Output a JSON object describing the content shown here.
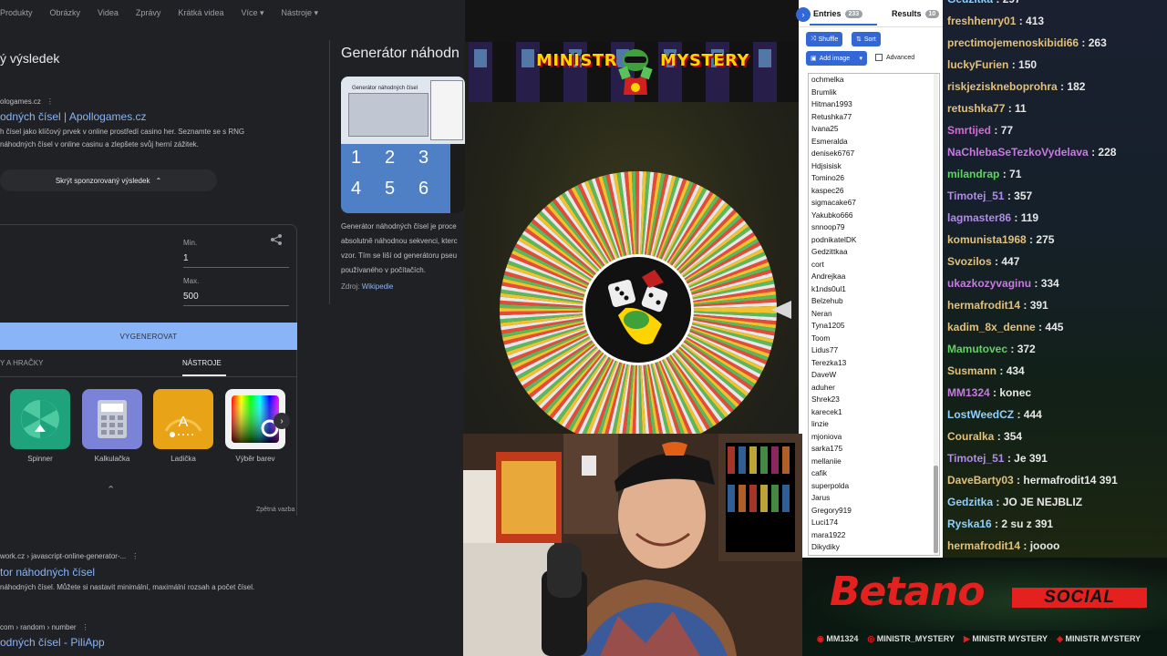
{
  "search": {
    "nav": [
      "Produkty",
      "Obrázky",
      "Videa",
      "Zprávy",
      "Krátká videa",
      "Více ▾",
      "Nástroje ▾"
    ],
    "sponsored_heading": "ý výsledek",
    "result1": {
      "site": "ologames.cz",
      "title": "odných čísel | Apollogames.cz",
      "snippet_line1": "h čísel jako klíčový prvek v online prostředí casino her.  Seznamte se s RNG",
      "snippet_line2": "náhodných čísel v online casinu  a zlepšete svůj herní zážitek."
    },
    "hide_sponsored": "Skrýt sponzorovaný výsledek",
    "rng": {
      "min_label": "Min.",
      "min_value": "1",
      "max_label": "Max.",
      "max_value": "500",
      "generate": "VYGENEROVAT"
    },
    "tools_tabs": [
      "Y A HRAČKY",
      "NÁSTROJE"
    ],
    "tools": [
      {
        "label": "Spinner",
        "color": "#1fa37c"
      },
      {
        "label": "Kalkulačka",
        "color": "#7b83d9"
      },
      {
        "label": "Ladička",
        "color": "#e8a317"
      },
      {
        "label": "Výběr barev",
        "color": "#f2f2f2"
      }
    ],
    "feedback": "Zpětná vazba",
    "result2": {
      "site": "work.cz › javascript-online-generator-...",
      "title": "tor náhodných čísel",
      "snippet": "náhodných čísel. Můžete si nastavit minimální, maximální rozsah a počet čísel."
    },
    "result3": {
      "site": "com › random › number",
      "title": "odných čísel - PiliApp"
    },
    "knowledge": {
      "title": "Generátor náhodn",
      "line1": "Generátor náhodných čísel je proce",
      "line2": "absolutně náhodnou sekvenci, kterc",
      "line3": "vzor. Tím se liší od generátoru pseu",
      "line4": "používaného v počítačích.",
      "source_label": "Zdroj:",
      "source": "Wikipedie",
      "img_title": "Generátor náhodných čísel",
      "img_digits": [
        "1",
        "2",
        "3",
        "4",
        "5",
        "6"
      ]
    }
  },
  "wheel": {
    "banner_left": "MINISTR",
    "banner_right": "MYSTERY",
    "colors": [
      "#f2c12e",
      "#5cb85c",
      "#e8e8e8",
      "#e84a3a",
      "#f2c12e",
      "#5cb85c",
      "#e84a3a",
      "#e8e8e8"
    ]
  },
  "entries": {
    "tab_entries": "Entries",
    "entries_count": "233",
    "tab_results": "Results",
    "results_count": "10",
    "shuffle": "Shuffle",
    "sort": "Sort",
    "add_image": "Add image",
    "advanced": "Advanced",
    "names": [
      "ochmelka",
      "Brumlik",
      "Hitman1993",
      "Retushka77",
      "Ivana25",
      "Esmeralda",
      "denisek6767",
      "Hdjsisisk",
      "Tomino26",
      "kaspec26",
      "sigmacake67",
      "Yakubko666",
      "snnoop79",
      "podnikatelDK",
      "Gedzittkaa",
      "cort",
      "Andrejkaa",
      "k1nds0ul1",
      "Belzehub",
      "Neran",
      "Tyna1205",
      "Toom",
      "Lidus77",
      "Terezka13",
      "DaveW",
      "aduher",
      "Shrek23",
      "karecek1",
      "linzie",
      "mjoniova",
      "sarka175",
      "mellaniie",
      "cafik",
      "superpolda",
      "Jarus",
      "Gregory919",
      "Luci174",
      "mara1922",
      "Dikydiky"
    ]
  },
  "chat": [
    {
      "user": "Gedzitka",
      "msg": "297",
      "color": "#8fd0ff"
    },
    {
      "user": "freshhenry01",
      "msg": "413",
      "color": "#e2c07a"
    },
    {
      "user": "prectimojemenoskibidi66",
      "msg": "263",
      "color": "#e2c07a"
    },
    {
      "user": "luckyFurien",
      "msg": "150",
      "color": "#e2c07a"
    },
    {
      "user": "riskjeziskneboprohra",
      "msg": "182",
      "color": "#e2c07a"
    },
    {
      "user": "retushka77",
      "msg": "11",
      "color": "#e2c07a"
    },
    {
      "user": "Smrtijed",
      "msg": "77",
      "color": "#d66ad6"
    },
    {
      "user": "NaChlebaSeTezkoVydelava",
      "msg": "228",
      "color": "#c87ae0"
    },
    {
      "user": "milandrap",
      "msg": "71",
      "color": "#5fd35f"
    },
    {
      "user": "Timotej_51",
      "msg": "357",
      "color": "#b08ae8"
    },
    {
      "user": "lagmaster86",
      "msg": "119",
      "color": "#b08ae8"
    },
    {
      "user": "komunista1968",
      "msg": "275",
      "color": "#e2c07a"
    },
    {
      "user": "Svozilos",
      "msg": "447",
      "color": "#e2c07a"
    },
    {
      "user": "ukazkozyvaginu",
      "msg": "334",
      "color": "#c87ae0"
    },
    {
      "user": "hermafrodit14",
      "msg": "391",
      "color": "#e2c07a"
    },
    {
      "user": "kadim_8x_denne",
      "msg": "445",
      "color": "#e2c07a"
    },
    {
      "user": "Mamutovec",
      "msg": "372",
      "color": "#5fd35f"
    },
    {
      "user": "Susmann",
      "msg": "434",
      "color": "#e2c07a"
    },
    {
      "user": "MM1324",
      "msg": "konec",
      "color": "#c87ae0"
    },
    {
      "user": "LostWeedCZ",
      "msg": "444",
      "color": "#8fd0ff"
    },
    {
      "user": "Couralka",
      "msg": "354",
      "color": "#e2c07a"
    },
    {
      "user": "Timotej_51",
      "msg": "Je 391",
      "color": "#b08ae8"
    },
    {
      "user": "DaveBarty03",
      "msg": "hermafrodit14 391",
      "color": "#e2c07a"
    },
    {
      "user": "Gedzitka",
      "msg": "JO JE NEJBLIZ",
      "color": "#8fd0ff"
    },
    {
      "user": "Ryska16",
      "msg": "2 su z 391",
      "color": "#8fd0ff"
    },
    {
      "user": "hermafrodit14",
      "msg": "joooo",
      "color": "#e2c07a"
    }
  ],
  "betano": {
    "logo": "Betano",
    "social": "SOCIAL",
    "handles": [
      "MM1324",
      "MINISTR_MYSTERY",
      "MINISTR MYSTERY",
      "MINISTR MYSTERY"
    ]
  }
}
